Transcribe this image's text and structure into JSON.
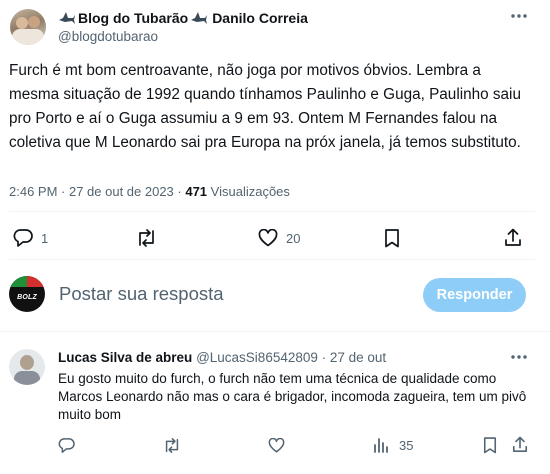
{
  "tweet": {
    "display_name": "Blog do Tubarão",
    "display_name_2": "Danilo Correia",
    "handle": "@blogdotubarao",
    "text": "Furch é mt bom centroavante, não joga por motivos óbvios. Lembra a mesma situação de 1992 quando tínhamos Paulinho e Guga, Paulinho saiu pro Porto e aí o Guga assumiu a 9 em 93. Ontem M Fernandes falou na coletiva que M Leonardo sai pra Europa na próx janela, já temos substituto.",
    "timestamp": "2:46 PM · 27 de out de 2023 · ",
    "views_count": "471",
    "views_label": " Visualizações",
    "reply_count": "1",
    "like_count": "20",
    "more_icon": "more-dots-icon"
  },
  "compose": {
    "placeholder": "Postar sua resposta",
    "button_label": "Responder",
    "avatar_text": "BOLZ",
    "button_color": "#8ecdf7"
  },
  "reply": {
    "display_name": "Lucas Silva de abreu",
    "handle": "@LucasSi86542809",
    "separator": " · ",
    "date": "27 de out",
    "text": "Eu gosto muito do furch, o furch não tem uma técnica de qualidade como Marcos Leonardo não mas o cara é brigador, incomoda zagueira, tem um pivô muito bom",
    "views_count": "35"
  },
  "colors": {
    "text": "#0f1419",
    "muted": "#536471",
    "divider": "#eff3f4",
    "accent": "#1d9bf0"
  }
}
